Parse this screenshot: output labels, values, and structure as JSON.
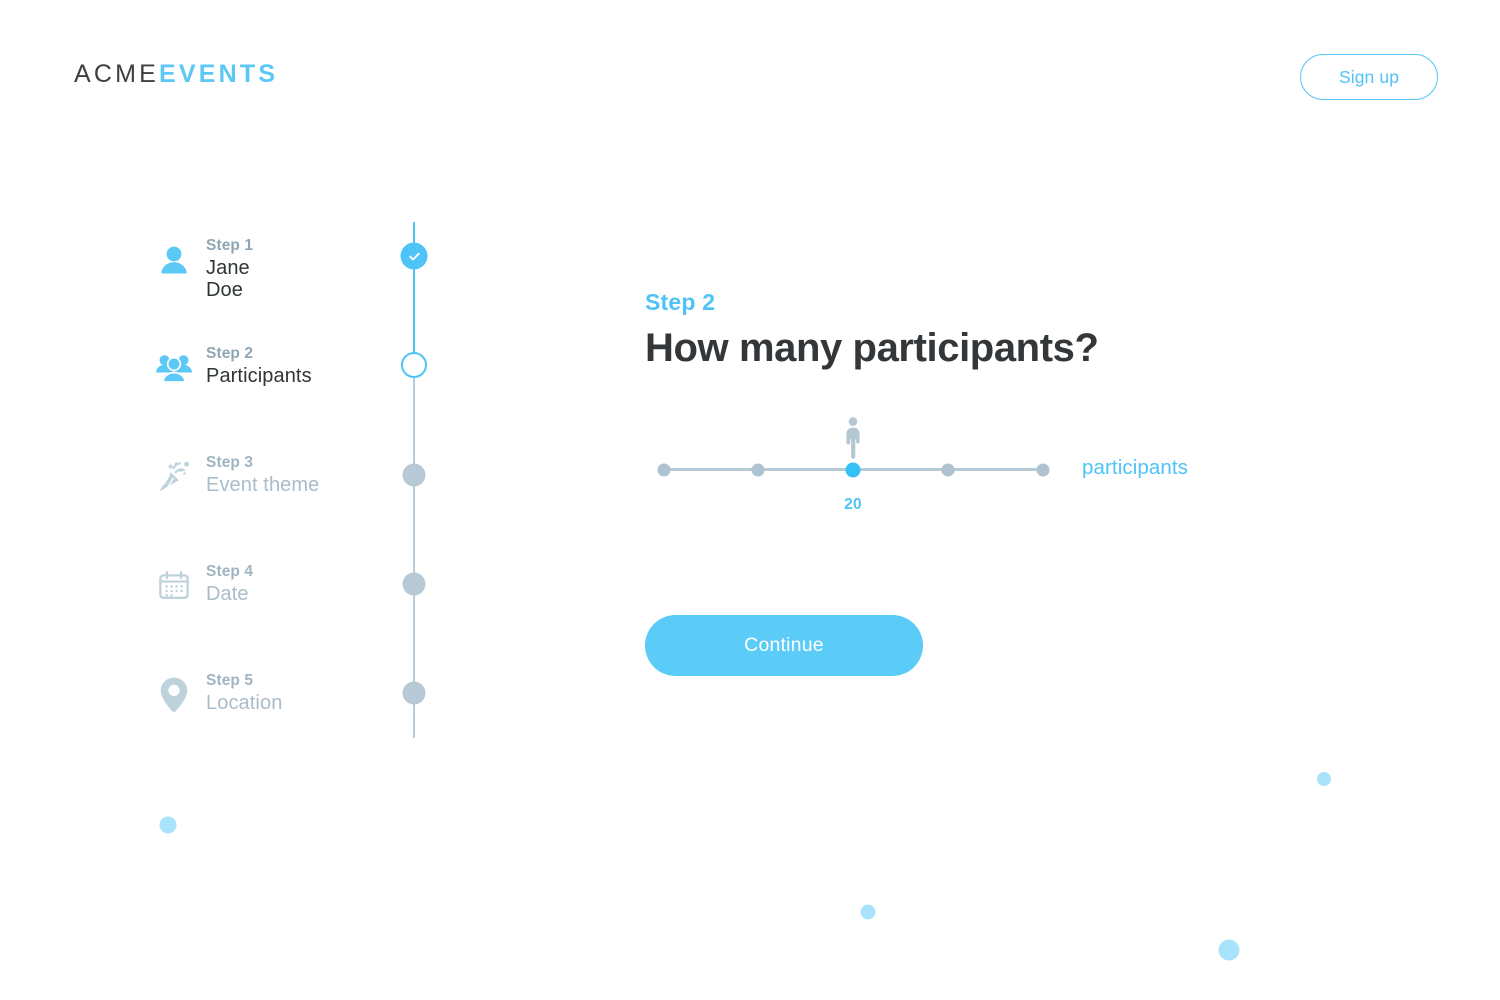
{
  "header": {
    "logo_primary": "ACME",
    "logo_accent": "EVENTS",
    "signup_label": "Sign up"
  },
  "colors": {
    "accent_blue": "#4ec3f7",
    "accent_blue_strong": "#35c1f7",
    "button_blue": "#5bcbf7",
    "inactive_gray": "#a9bdc9",
    "node_gray": "#b6c9d4",
    "text_dark": "#2f3437",
    "deco_dot": "#a9e3fb"
  },
  "stepper": {
    "steps": [
      {
        "kicker": "Step 1",
        "name": "Jane\nDoe",
        "name_lines": [
          "Jane",
          "Doe"
        ],
        "icon": "person-icon",
        "state": "done"
      },
      {
        "kicker": "Step 2",
        "name": "Participants",
        "name_lines": [
          "Participants"
        ],
        "icon": "people-group-icon",
        "state": "current"
      },
      {
        "kicker": "Step 3",
        "name": "Event theme",
        "name_lines": [
          "Event theme"
        ],
        "icon": "party-popper-icon",
        "state": "todo"
      },
      {
        "kicker": "Step 4",
        "name": "Date",
        "name_lines": [
          "Date"
        ],
        "icon": "calendar-icon",
        "state": "todo"
      },
      {
        "kicker": "Step 5",
        "name": "Location",
        "name_lines": [
          "Location"
        ],
        "icon": "map-pin-icon",
        "state": "todo"
      }
    ]
  },
  "main": {
    "kicker": "Step 2",
    "title": "How many participants?",
    "continue_label": "Continue",
    "slider": {
      "value": "20",
      "unit_label": "participants",
      "selected_index": 2,
      "stops": [
        "",
        "",
        "20",
        "",
        ""
      ],
      "stop_count": 5
    }
  }
}
